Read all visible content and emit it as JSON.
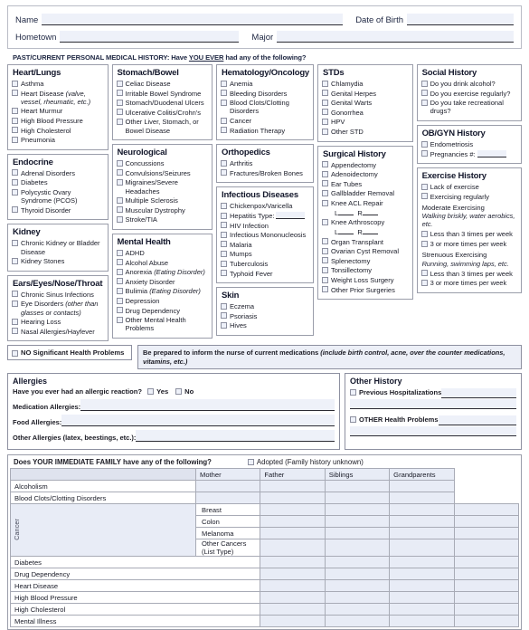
{
  "identity": {
    "name_label": "Name",
    "dob_label": "Date of Birth",
    "hometown_label": "Hometown",
    "major_label": "Major",
    "name_value": "",
    "dob_value": "",
    "hometown_value": "",
    "major_value": ""
  },
  "history_header": {
    "prefix": "PAST/CURRENT PERSONAL MEDICAL HISTORY: Have ",
    "emphasis": "YOU EVER",
    "suffix": " had any of the following?"
  },
  "sections": {
    "heart_lungs": {
      "title": "Heart/Lungs",
      "items": [
        {
          "label": "Asthma"
        },
        {
          "label": "Heart Disease ",
          "italic": "(valve, vessel, rheumatic, etc.)"
        },
        {
          "label": "Heart Murmur"
        },
        {
          "label": "High Blood Pressure"
        },
        {
          "label": "High Cholesterol"
        },
        {
          "label": "Pneumonia"
        }
      ]
    },
    "endocrine": {
      "title": "Endocrine",
      "items": [
        {
          "label": "Adrenal Disorders"
        },
        {
          "label": "Diabetes"
        },
        {
          "label": "Polycystic Ovary Syndrome (PCOS)"
        },
        {
          "label": "Thyroid Disorder"
        }
      ]
    },
    "kidney": {
      "title": "Kidney",
      "items": [
        {
          "label": "Chronic Kidney or Bladder Disease"
        },
        {
          "label": "Kidney Stones"
        }
      ]
    },
    "eent": {
      "title": "Ears/Eyes/Nose/Throat",
      "items": [
        {
          "label": "Chronic Sinus Infections"
        },
        {
          "label": "Eye Disorders ",
          "italic": "(other than glasses or contacts)"
        },
        {
          "label": "Hearing Loss"
        },
        {
          "label": "Nasal Allergies/Hayfever"
        }
      ]
    },
    "stomach_bowel": {
      "title": "Stomach/Bowel",
      "items": [
        {
          "label": "Celiac Disease"
        },
        {
          "label": "Irritable Bowel Syndrome"
        },
        {
          "label": "Stomach/Duodenal Ulcers"
        },
        {
          "label": "Ulcerative Colitis/Crohn's"
        },
        {
          "label": "Other Liver, Stomach, or Bowel Disease"
        }
      ]
    },
    "neurological": {
      "title": "Neurological",
      "items": [
        {
          "label": "Concussions"
        },
        {
          "label": "Convulsions/Seizures"
        },
        {
          "label": "Migraines/Severe Headaches"
        },
        {
          "label": "Multiple Sclerosis"
        },
        {
          "label": "Muscular Dystrophy"
        },
        {
          "label": "Stroke/TIA"
        }
      ]
    },
    "mental_health": {
      "title": "Mental Health",
      "items": [
        {
          "label": "ADHD"
        },
        {
          "label": "Alcohol Abuse"
        },
        {
          "label": "Anorexia ",
          "italic": "(Eating Disorder)"
        },
        {
          "label": "Anxiety Disorder"
        },
        {
          "label": "Bulimia ",
          "italic": "(Eating Disorder)"
        },
        {
          "label": "Depression"
        },
        {
          "label": "Drug Dependency"
        },
        {
          "label": "Other Mental Health Problems"
        }
      ]
    },
    "hematology_oncology": {
      "title": "Hematology/Oncology",
      "items": [
        {
          "label": "Anemia"
        },
        {
          "label": "Bleeding Disorders"
        },
        {
          "label": "Blood Clots/Clotting Disorders"
        },
        {
          "label": "Cancer"
        },
        {
          "label": "Radiation Therapy"
        }
      ]
    },
    "orthopedics": {
      "title": "Orthopedics",
      "items": [
        {
          "label": "Arthritis"
        },
        {
          "label": "Fractures/Broken Bones"
        }
      ]
    },
    "infectious_diseases": {
      "title": "Infectious Diseases",
      "items": [
        {
          "label": "Chickenpox/Varicella"
        },
        {
          "label": "Hepatitis Type:",
          "blank": true
        },
        {
          "label": "HIV Infection"
        },
        {
          "label": "Infectious Mononucleosis"
        },
        {
          "label": "Malaria"
        },
        {
          "label": "Mumps"
        },
        {
          "label": "Tuberculosis"
        },
        {
          "label": "Typhoid Fever"
        }
      ]
    },
    "skin": {
      "title": "Skin",
      "items": [
        {
          "label": "Eczema"
        },
        {
          "label": "Psoriasis"
        },
        {
          "label": "Hives"
        }
      ]
    },
    "stds": {
      "title": "STDs",
      "items": [
        {
          "label": "Chlamydia"
        },
        {
          "label": "Genital Herpes"
        },
        {
          "label": "Genital Warts"
        },
        {
          "label": "Gonorrhea"
        },
        {
          "label": "HPV"
        },
        {
          "label": "Other STD"
        }
      ]
    },
    "surgical_history": {
      "title": "Surgical History",
      "items": [
        {
          "label": "Appendectomy"
        },
        {
          "label": "Adenoidectomy"
        },
        {
          "label": "Ear Tubes"
        },
        {
          "label": "Gallbladder Removal"
        },
        {
          "label": "Knee ACL Repair",
          "lr": "L ___  R ___"
        },
        {
          "label": "Knee Arthroscopy",
          "lr": "L ___  R ___"
        },
        {
          "label": "Organ Transplant"
        },
        {
          "label": "Ovarian Cyst Removal"
        },
        {
          "label": "Splenectomy"
        },
        {
          "label": "Tonsillectomy"
        },
        {
          "label": "Weight Loss Surgery"
        },
        {
          "label": "Other Prior Surgeries"
        }
      ],
      "lr_left": "L",
      "lr_right": "R"
    },
    "social_history": {
      "title": "Social History",
      "items": [
        {
          "label": "Do you drink alcohol?"
        },
        {
          "label": "Do you exercise regularly?"
        },
        {
          "label": "Do you take recreational drugs?"
        }
      ]
    },
    "obgyn_history": {
      "title": "OB/GYN History",
      "items": [
        {
          "label": "Endometriosis"
        },
        {
          "label": "Pregnancies #:",
          "blank": true
        }
      ]
    },
    "exercise_history": {
      "title": "Exercise History",
      "items_top": [
        {
          "label": "Lack of exercise"
        },
        {
          "label": "Exercising regularly"
        }
      ],
      "moderate_title": "Moderate Exercising",
      "moderate_examples": "Walking briskly, water aerobics, etc.",
      "moderate_items": [
        {
          "label": "Less than 3 times per week"
        },
        {
          "label": "3 or more times per week"
        }
      ],
      "strenuous_title": "Strenuous Exercising",
      "strenuous_examples": "Running, swimming laps, etc.",
      "strenuous_items": [
        {
          "label": "Less than 3 times per week"
        },
        {
          "label": "3 or more times per week"
        }
      ]
    }
  },
  "no_significant": {
    "label": "NO Significant Health Problems"
  },
  "medication_note": {
    "bold": "Be prepared to inform the nurse of current medications ",
    "italic": "(include birth control, acne, over the counter medications, vitamins, etc.)"
  },
  "allergies": {
    "title": "Allergies",
    "question": "Have you ever had an allergic reaction?",
    "yes_label": "Yes",
    "no_label": "No",
    "fields": [
      {
        "label": "Medication Allergies:",
        "value": ""
      },
      {
        "label": "Food Allergies:",
        "value": ""
      },
      {
        "label": "Other Allergies (latex, beestings, etc.):",
        "value": ""
      }
    ]
  },
  "other_history": {
    "title": "Other History",
    "items": [
      {
        "label": "Previous Hospitalizations",
        "value": "",
        "value2": ""
      },
      {
        "label": "OTHER Health Problems",
        "value": "",
        "value2": ""
      }
    ]
  },
  "family_history": {
    "question": "Does YOUR IMMEDIATE FAMILY have any of the following?",
    "adopted_label": "Adopted (Family history unknown)",
    "columns": [
      "Mother",
      "Father",
      "Siblings",
      "Grandparents"
    ],
    "cancer_group_label": "Cancer",
    "rows": [
      {
        "label": "Alcoholism",
        "indent": false,
        "values": [
          "",
          "",
          "",
          ""
        ]
      },
      {
        "label": "Blood Clots/Clotting Disorders",
        "indent": false,
        "values": [
          "",
          "",
          "",
          ""
        ]
      },
      {
        "label": "Breast",
        "indent": true,
        "group": "cancer",
        "values": [
          "",
          "",
          "",
          ""
        ]
      },
      {
        "label": "Colon",
        "indent": true,
        "group": "cancer",
        "values": [
          "",
          "",
          "",
          ""
        ]
      },
      {
        "label": "Melanoma",
        "indent": true,
        "group": "cancer",
        "values": [
          "",
          "",
          "",
          ""
        ]
      },
      {
        "label": "Other Cancers (List Type)",
        "indent": true,
        "group": "cancer",
        "values": [
          "",
          "",
          "",
          ""
        ]
      },
      {
        "label": "Diabetes",
        "indent": false,
        "values": [
          "",
          "",
          "",
          ""
        ]
      },
      {
        "label": "Drug Dependency",
        "indent": false,
        "values": [
          "",
          "",
          "",
          ""
        ]
      },
      {
        "label": "Heart Disease",
        "indent": false,
        "values": [
          "",
          "",
          "",
          ""
        ]
      },
      {
        "label": "High Blood Pressure",
        "indent": false,
        "values": [
          "",
          "",
          "",
          ""
        ]
      },
      {
        "label": "High Cholesterol",
        "indent": false,
        "values": [
          "",
          "",
          "",
          ""
        ]
      },
      {
        "label": "Mental Illness",
        "indent": false,
        "values": [
          "",
          "",
          "",
          ""
        ]
      }
    ]
  },
  "colors": {
    "field_fill": "#eef1f9",
    "cell_fill": "#e8ecf6",
    "border": "#9a9daa",
    "text": "#191b27"
  }
}
